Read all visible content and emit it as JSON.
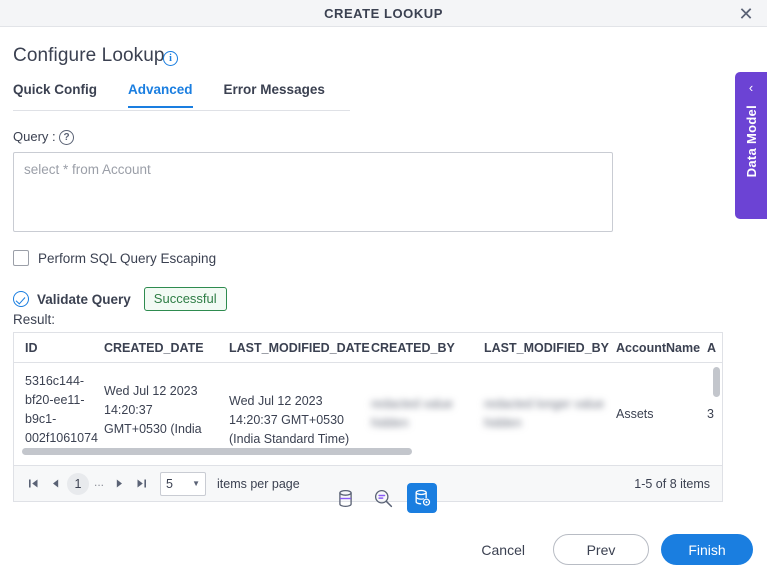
{
  "window": {
    "title": "CREATE LOOKUP",
    "close_label": "✕"
  },
  "page": {
    "title": "Configure Lookup",
    "info_icon_glyph": "i"
  },
  "tabs": [
    {
      "label": "Quick Config",
      "active": false
    },
    {
      "label": "Advanced",
      "active": true
    },
    {
      "label": "Error Messages",
      "active": false
    }
  ],
  "query": {
    "label": "Query :",
    "help_icon_glyph": "?",
    "placeholder": "select * from Account",
    "value": ""
  },
  "escaping": {
    "label": "Perform SQL Query Escaping",
    "checked": false
  },
  "validate": {
    "label": "Validate Query",
    "status": "Successful",
    "status_color": "#2e7d45",
    "result_label": "Result:"
  },
  "table": {
    "columns": [
      "ID",
      "CREATED_DATE",
      "LAST_MODIFIED_DATE",
      "CREATED_BY",
      "LAST_MODIFIED_BY",
      "AccountName",
      "A"
    ],
    "row": {
      "id": "5316c144-\nbf20-ee11-\nb9c1-\n002f1061074",
      "created_date": "Wed Jul 12 2023\n14:20:37\nGMT+0530 (India",
      "last_modified_date": "Wed Jul 12 2023\n14:20:37 GMT+0530\n(India Standard Time)",
      "created_by": "redacted value\nhidden",
      "last_modified_by": "redacted longer value\nhidden",
      "account_name": "Assets",
      "a": "3"
    }
  },
  "pagination": {
    "first_glyph": "⏮",
    "prev_glyph": "◀",
    "page": "1",
    "ellipsis": "...",
    "next_glyph": "▶",
    "last_glyph": "⏭",
    "page_size": "5",
    "caret_glyph": "▼",
    "items_per_page_label": "items per page",
    "range_label": "1-5 of 8 items"
  },
  "toolbar": {
    "database_icon": "database-icon",
    "query_search_icon": "search-query-icon",
    "configure_icon": "database-configure-icon",
    "active_color": "#1a7ee0"
  },
  "footer": {
    "cancel_label": "Cancel",
    "prev_label": "Prev",
    "finish_label": "Finish",
    "primary_color": "#1a7ee0"
  },
  "side_panel": {
    "label": "Data Model",
    "chevron_glyph": "‹",
    "color": "#6c43d4"
  }
}
